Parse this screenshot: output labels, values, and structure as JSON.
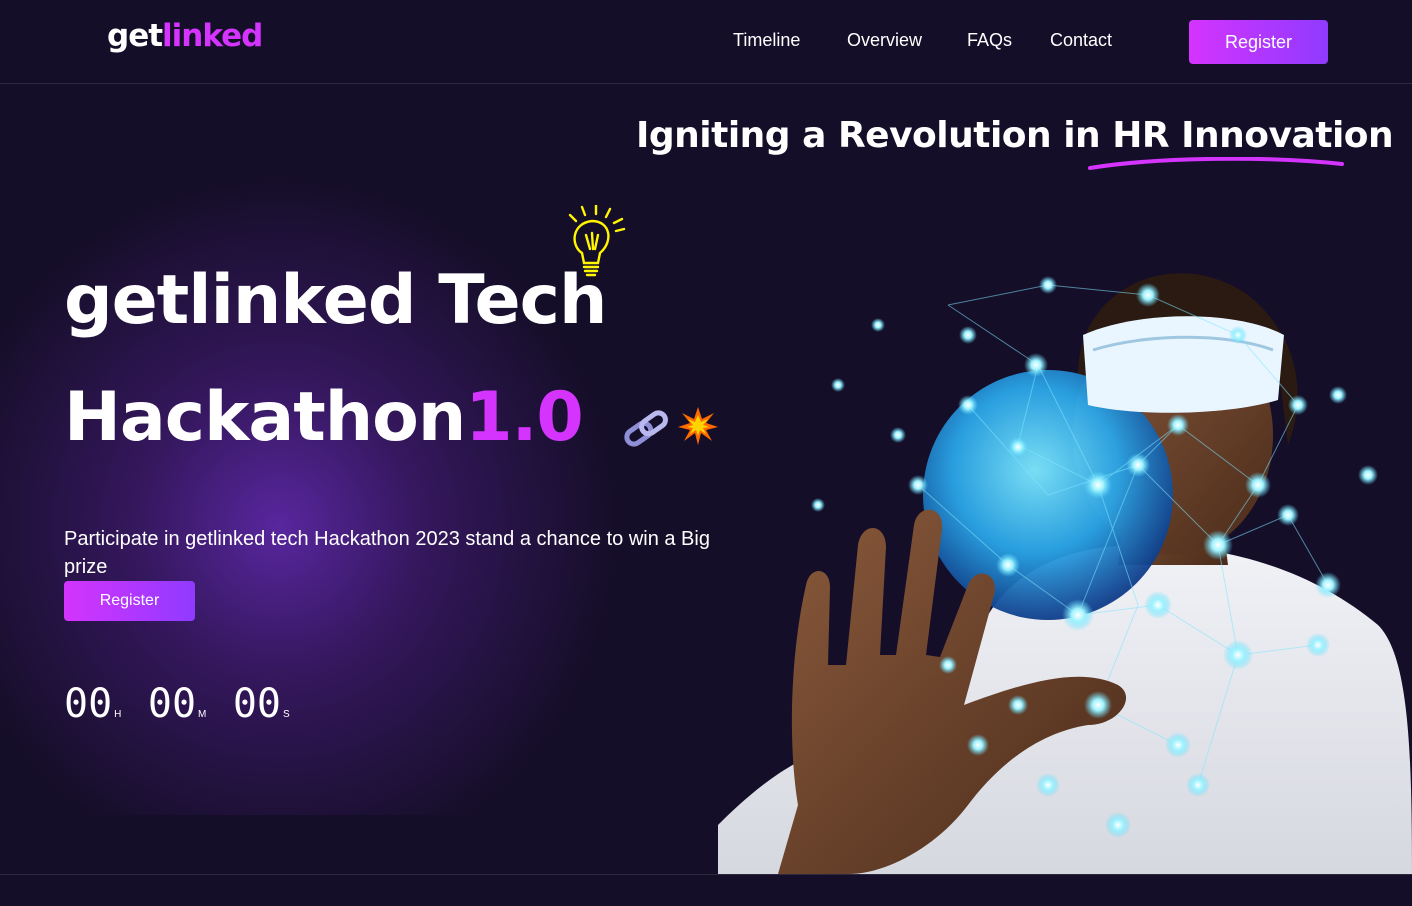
{
  "nav": {
    "logo_part1": "get",
    "logo_part2": "linked",
    "links": [
      "Timeline",
      "Overview",
      "FAQs",
      "Contact"
    ],
    "register_label": "Register"
  },
  "hero": {
    "tagline_part1": "Igniting a Revolution in ",
    "tagline_part2": "HR Innovation",
    "title_line1": "getlinked Tech",
    "title_line2_a": "Hackathon",
    "title_line2_b": "1.0",
    "description": "Participate in getlinked tech Hackathon 2023 stand a chance to win a Big prize",
    "register_label": "Register",
    "countdown": {
      "hours": "00",
      "hours_unit": "H",
      "minutes": "00",
      "minutes_unit": "M",
      "seconds": "00",
      "seconds_unit": "S"
    }
  },
  "colors": {
    "background": "#150e28",
    "accent": "#d434fe",
    "accent_end": "#903aff",
    "bulb": "#fff600"
  },
  "icons": [
    "lightbulb-icon",
    "chain-link-icon",
    "spark-icon"
  ]
}
